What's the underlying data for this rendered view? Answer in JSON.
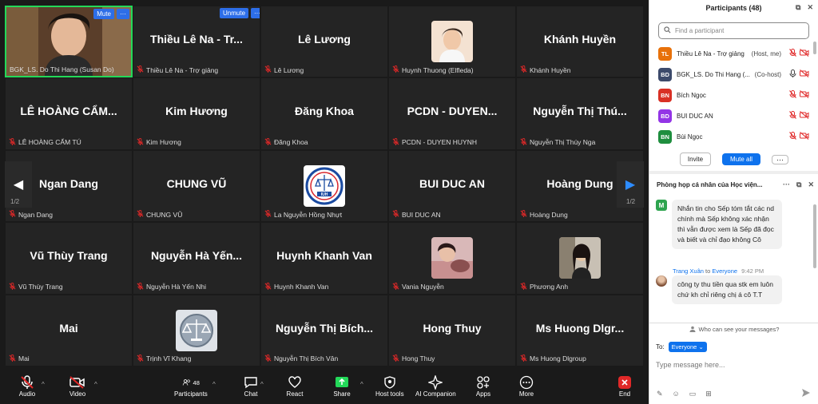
{
  "gallery": {
    "tiles": [
      {
        "big": "",
        "footer": "BGK_LS. Do Thi Hang (Susan Do)",
        "muted": false,
        "active": true,
        "type": "video",
        "buttons": [
          "Mute",
          "···"
        ]
      },
      {
        "big": "Thiều Lê Na - Tr...",
        "footer": "Thiều Lê Na - Trợ giảng",
        "muted": true,
        "buttons": [
          "Unmute",
          "···"
        ]
      },
      {
        "big": "Lê Lương",
        "footer": "Lê Lương",
        "muted": true
      },
      {
        "big": "",
        "footer": "Huynh Thuong (Elfleda)",
        "muted": true,
        "type": "photo-woman"
      },
      {
        "big": "Khánh Huyền",
        "footer": "Khánh Huyền",
        "muted": true
      },
      {
        "big": "LÊ HOÀNG CẨM...",
        "footer": "LÊ HOÀNG CẨM TÚ",
        "muted": true
      },
      {
        "big": "Kim Hương",
        "footer": "Kim Hương",
        "muted": true
      },
      {
        "big": "Đăng Khoa",
        "footer": "Đăng Khoa",
        "muted": true
      },
      {
        "big": "PCDN - DUYEN...",
        "footer": "PCDN - DUYEN HUYNH",
        "muted": true
      },
      {
        "big": "Nguyễn Thị Thú...",
        "footer": "Nguyễn Thị Thúy Nga",
        "muted": true
      },
      {
        "big": "Ngan Dang",
        "footer": "Ngan Dang",
        "muted": true
      },
      {
        "big": "CHUNG VŨ",
        "footer": "CHUNG VŨ",
        "muted": true
      },
      {
        "big": "",
        "footer": "La Nguyễn Hồng Nhựt",
        "muted": true,
        "type": "logo-iuh"
      },
      {
        "big": "BUI DUC AN",
        "footer": "BUI DUC AN",
        "muted": true
      },
      {
        "big": "Hoàng Dung",
        "footer": "Hoàng Dung",
        "muted": true
      },
      {
        "big": "Vũ Thùy Trang",
        "footer": "Vũ Thùy Trang",
        "muted": true
      },
      {
        "big": "Nguyễn Hà Yến...",
        "footer": "Nguyễn Hà Yến Nhi",
        "muted": true
      },
      {
        "big": "Huynh Khanh Van",
        "footer": "Huynh Khanh Van",
        "muted": true
      },
      {
        "big": "",
        "footer": "Vania Nguyễn",
        "muted": true,
        "type": "photo-pink"
      },
      {
        "big": "",
        "footer": "Phương Anh",
        "muted": true,
        "type": "photo-dark"
      },
      {
        "big": "Mai",
        "footer": "Mai",
        "muted": true
      },
      {
        "big": "",
        "footer": "Trịnh Vĩ Khang",
        "muted": true,
        "type": "logo-scale"
      },
      {
        "big": "Nguyễn Thị Bích...",
        "footer": "Nguyễn Thị Bích Vân",
        "muted": true
      },
      {
        "big": "Hong Thuy",
        "footer": "Hong Thuy",
        "muted": true
      },
      {
        "big": "Ms Huong Dlgr...",
        "footer": "Ms Huong Dlgroup",
        "muted": true
      }
    ],
    "page_left": "1/2",
    "page_right": "1/2",
    "iuh_text": "IUH"
  },
  "toolbar": {
    "audio": "Audio",
    "video": "Video",
    "participants": "Participants",
    "participants_count": "48",
    "chat": "Chat",
    "react": "React",
    "share": "Share",
    "host_tools": "Host tools",
    "ai_companion": "AI Companion",
    "apps": "Apps",
    "more": "More",
    "end": "End"
  },
  "participants_panel": {
    "title": "Participants (48)",
    "search_placeholder": "Find a participant",
    "rows": [
      {
        "initials": "TL",
        "color": "#e8710a",
        "name": "Thiều Lê Na - Trợ giảng",
        "role": "(Host, me)"
      },
      {
        "initials": "BD",
        "color": "#3c4a6b",
        "name": "BGK_LS. Do Thi Hang (...",
        "role": "(Co-host)"
      },
      {
        "initials": "BN",
        "color": "#d93025",
        "name": "Bích Ngọc",
        "role": ""
      },
      {
        "initials": "BD",
        "color": "#9334e6",
        "name": "BUI DUC AN",
        "role": ""
      },
      {
        "initials": "BN",
        "color": "#1e8e3e",
        "name": "Bùi Ngọc",
        "role": ""
      }
    ],
    "invite": "Invite",
    "mute_all": "Mute all",
    "more": "···"
  },
  "chat_panel": {
    "title": "Phòng họp cá nhân của Học viện...",
    "msg1_initial": "M",
    "msg1_text": "Nhắn tin cho Sếp tóm tắt các nd chính mà Sếp không xác nhận thì vẫn được xem là Sếp đã đọc và biết và chỉ đạo không Cô",
    "msg2_sender": "Trang Xuân",
    "msg2_to": "to",
    "msg2_recipient": "Everyone",
    "msg2_time": "9:42 PM",
    "msg2_text": "công ty thu tiền qua stk em luôn chứ kh chỉ riêng chị á cô T.T",
    "who_can_see": "Who can see your messages?",
    "to_label": "To:",
    "to_value": "Everyone",
    "input_placeholder": "Type message here..."
  }
}
